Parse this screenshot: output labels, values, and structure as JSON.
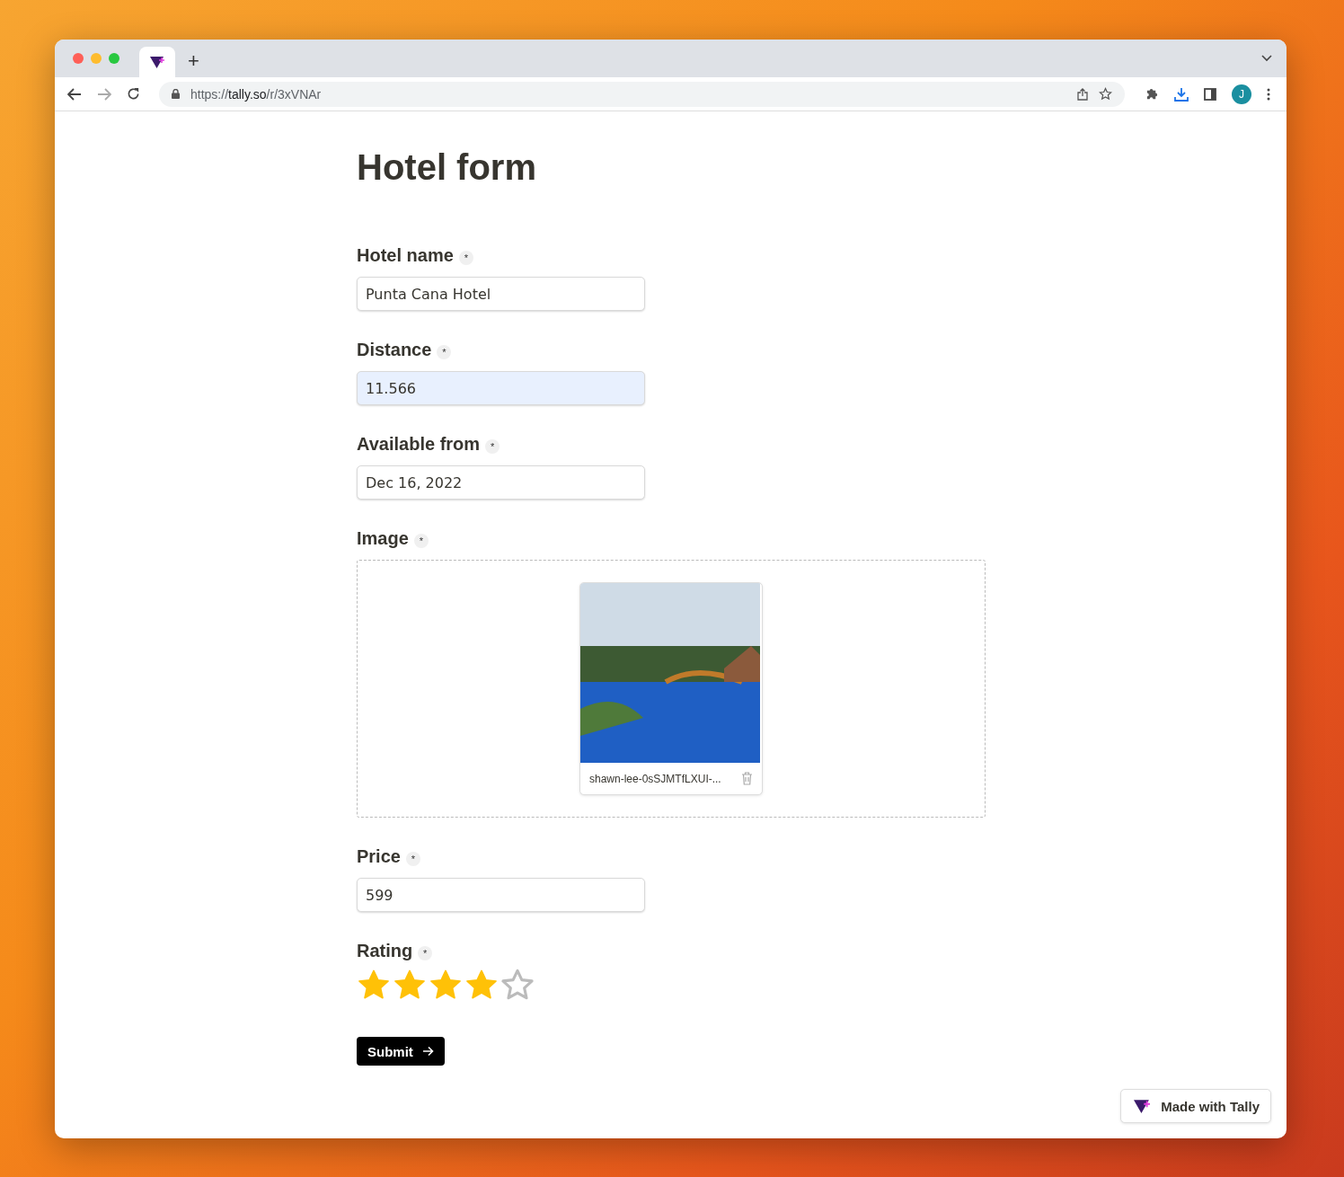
{
  "browser": {
    "url": {
      "scheme": "https://",
      "host": "tally.so",
      "path": "/r/3xVNAr"
    },
    "avatar": "J",
    "new_tab": "+"
  },
  "form": {
    "title": "Hotel form",
    "fields": [
      {
        "kind": "text",
        "label": "Hotel name",
        "required": "*",
        "value": "Punta Cana Hotel",
        "autofilled": false
      },
      {
        "kind": "text",
        "label": "Distance",
        "required": "*",
        "value": "11.566",
        "autofilled": true
      },
      {
        "kind": "text",
        "label": "Available from",
        "required": "*",
        "value": "Dec 16, 2022",
        "autofilled": false
      },
      {
        "kind": "file",
        "label": "Image",
        "required": "*",
        "file_name": "shawn-lee-0sSJMTfLXUI-..."
      },
      {
        "kind": "text",
        "label": "Price",
        "required": "*",
        "value": "599",
        "autofilled": false
      },
      {
        "kind": "rating",
        "label": "Rating",
        "required": "*",
        "stars": 4
      }
    ],
    "submit": "Submit"
  },
  "badge": "Made with Tally"
}
